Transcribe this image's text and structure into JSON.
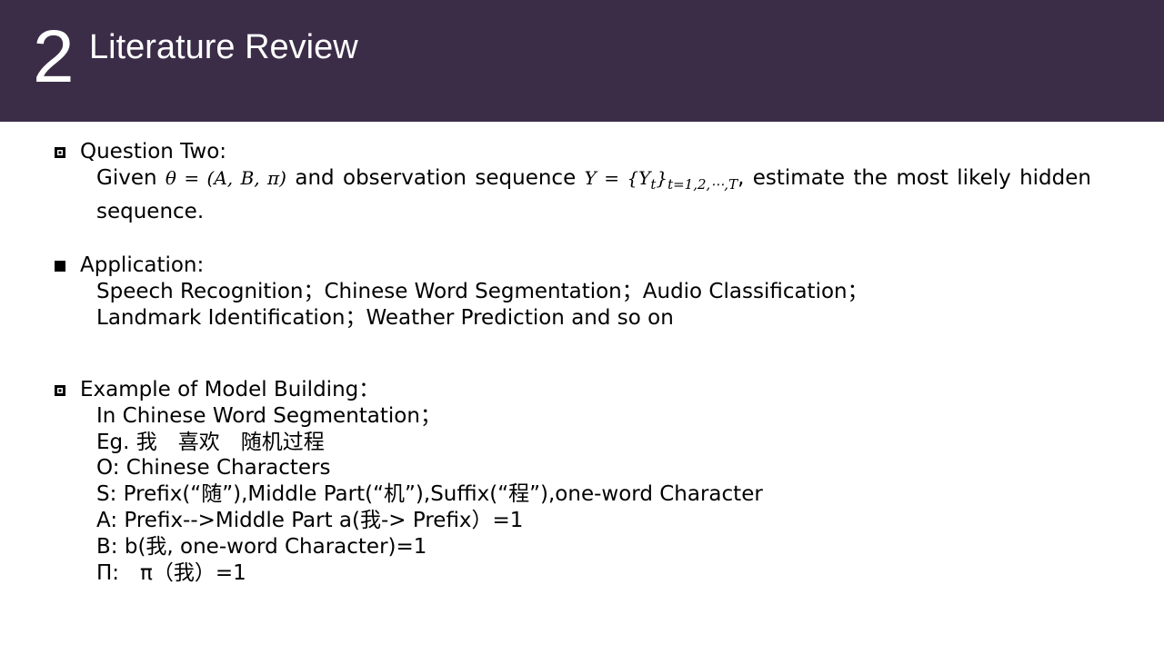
{
  "header": {
    "section_number": "2",
    "title": "Literature Review"
  },
  "q2": {
    "heading": "Question Two:",
    "text_before": "Given ",
    "math_theta": "θ = (A, B, π)",
    "text_mid": " and observation sequence ",
    "math_y": "Y = {Y",
    "math_y_sub_t": "t",
    "math_y_close": "}",
    "math_y_sub_range": "t=1,2,⋯,T",
    "text_after": ", estimate the most likely hidden sequence."
  },
  "application": {
    "heading": "Application:",
    "lines": [
      "Speech Recognition；Chinese Word Segmentation；Audio Classification；",
      "Landmark Identification；Weather Prediction and so on"
    ]
  },
  "example": {
    "heading": "Example of Model Building：",
    "lines": [
      "In Chinese Word Segmentation；",
      "Eg. 我　喜欢　随机过程",
      "O: Chinese Characters",
      "S: Prefix(“随”),Middle Part(“机”),Suffix(“程”),one-word Character",
      "A: Prefix-->Middle Part a(我-> Prefix）=1",
      "B: b(我, one-word Character)=1",
      "Π:　π（我）=1"
    ]
  }
}
